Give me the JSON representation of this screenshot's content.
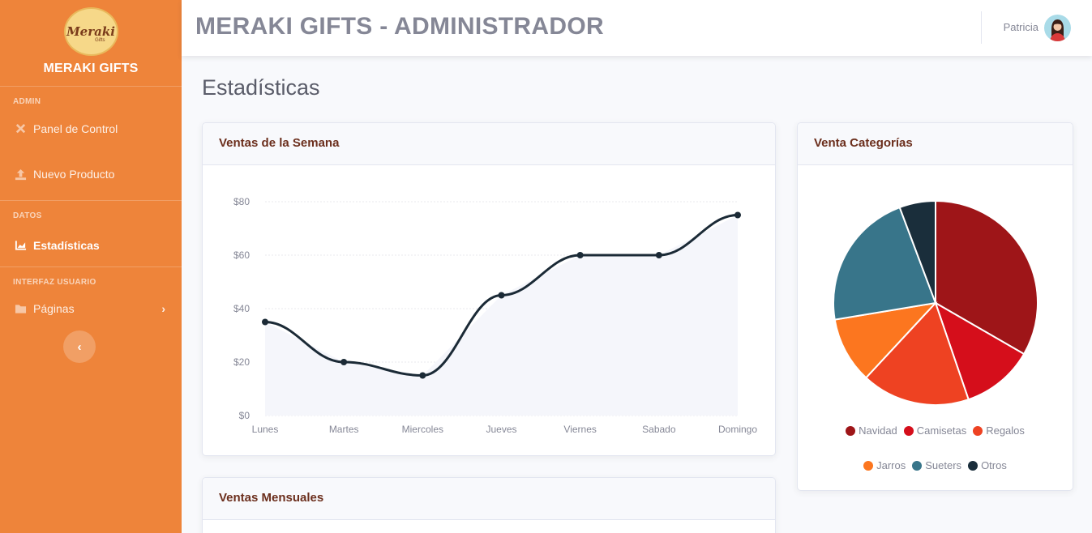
{
  "brand": {
    "logo_text": "Meraki",
    "logo_sub": "Gifts",
    "name": "MERAKI GIFTS"
  },
  "sidebar": {
    "sections": [
      {
        "heading": "ADMIN"
      },
      {
        "heading": "DATOS"
      },
      {
        "heading": "INTERFAZ USUARIO"
      }
    ],
    "items": [
      {
        "label": "Panel de Control",
        "icon": "tools-icon"
      },
      {
        "label": "Nuevo Producto",
        "icon": "upload-icon"
      },
      {
        "label": "Estadísticas",
        "icon": "area-chart-icon",
        "active": true
      },
      {
        "label": "Páginas",
        "icon": "folder-icon"
      }
    ],
    "toggle_icon": "chevron-left-icon"
  },
  "topbar": {
    "title": "MERAKI GIFTS - ADMINISTRADOR",
    "user_name": "Patricia"
  },
  "page": {
    "title": "Estadísticas"
  },
  "cards": {
    "week": {
      "title": "Ventas de la Semana"
    },
    "categories": {
      "title": "Venta Categorías"
    },
    "monthly": {
      "title": "Ventas Mensuales"
    }
  },
  "colors": {
    "sidebar": "#ee843a",
    "line": "#1b2a36",
    "area": "#f5f6fb"
  },
  "chart_data": [
    {
      "type": "line",
      "categories": [
        "Lunes",
        "Martes",
        "Miercoles",
        "Jueves",
        "Viernes",
        "Sabado",
        "Domingo"
      ],
      "values": [
        35,
        20,
        15,
        45,
        60,
        60,
        75
      ],
      "yticks": [
        "$0",
        "$20",
        "$40",
        "$60",
        "$80"
      ],
      "ylim": [
        0,
        80
      ],
      "grid": true
    },
    {
      "type": "pie",
      "labels": [
        "Navidad",
        "Camisetas",
        "Regalos",
        "Jarros",
        "Sueters",
        "Otros"
      ],
      "values": [
        35,
        12,
        18,
        11,
        23,
        6
      ],
      "colors": [
        "#9e1518",
        "#d50e1b",
        "#ee4222",
        "#fc761f",
        "#38758a",
        "#1a2e3b"
      ],
      "legend": "bottom"
    }
  ]
}
